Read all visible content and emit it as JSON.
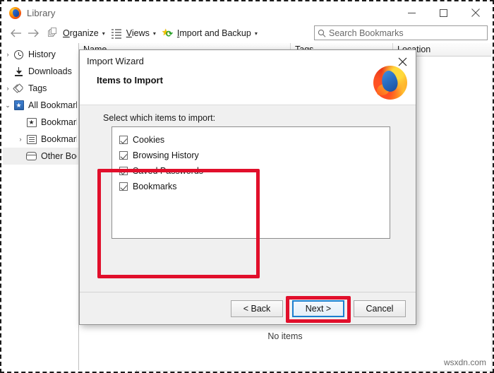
{
  "window": {
    "title": "Library",
    "app_icon": "firefox-icon",
    "controls": {
      "minimize": "minimize-icon",
      "maximize": "maximize-icon",
      "close": "close-icon"
    }
  },
  "toolbar": {
    "back": "back-arrow-icon",
    "forward": "forward-arrow-icon",
    "items": [
      {
        "label": "Organize",
        "key": "O",
        "rest": "rganize",
        "icon": "organize-icon",
        "caret": "▾"
      },
      {
        "label": "Views",
        "key": "V",
        "rest": "iews",
        "icon": "views-icon",
        "caret": "▾"
      },
      {
        "label": "Import and Backup",
        "key": "I",
        "rest": "mport and Backup",
        "icon": "import-backup-icon",
        "caret": "▾"
      }
    ]
  },
  "search": {
    "placeholder": "Search Bookmarks",
    "value": "",
    "icon": "search-icon"
  },
  "sidebar": {
    "items": [
      {
        "label": "History",
        "icon": "clock-icon",
        "twisty": "›",
        "indent": 0,
        "selected": false
      },
      {
        "label": "Downloads",
        "icon": "download-icon",
        "twisty": "",
        "indent": 0,
        "selected": false
      },
      {
        "label": "Tags",
        "icon": "tag-icon",
        "twisty": "›",
        "indent": 0,
        "selected": false
      },
      {
        "label": "All Bookmarks",
        "icon": "all-bookmarks-icon",
        "twisty": "⌄",
        "indent": 0,
        "selected": false
      },
      {
        "label": "Bookmarks Toolbar",
        "icon": "bookmarks-toolbar-icon",
        "twisty": "",
        "indent": 1,
        "selected": false
      },
      {
        "label": "Bookmarks Menu",
        "icon": "bookmarks-menu-icon",
        "twisty": "›",
        "indent": 1,
        "selected": false
      },
      {
        "label": "Other Bookmarks",
        "icon": "other-bookmarks-icon",
        "twisty": "",
        "indent": 1,
        "selected": true
      }
    ]
  },
  "content": {
    "columns": [
      "Name",
      "Tags",
      "Location"
    ],
    "empty_message": "No items"
  },
  "dialog": {
    "title": "Import Wizard",
    "subtitle": "Items to Import",
    "logo": "firefox-logo",
    "close_icon": "close-icon",
    "select_label": "Select which items to import:",
    "checkboxes": [
      {
        "label": "Cookies",
        "checked": true
      },
      {
        "label": "Browsing History",
        "checked": true
      },
      {
        "label": "Saved Passwords",
        "checked": true
      },
      {
        "label": "Bookmarks",
        "checked": true
      }
    ],
    "buttons": [
      {
        "label": "< Back",
        "focused": false
      },
      {
        "label": "Next >",
        "focused": true
      },
      {
        "label": "Cancel",
        "focused": false
      }
    ]
  },
  "annotations": {
    "highlight_color": "#e10f2b",
    "focus_color": "#1b7fcf"
  },
  "watermark": "wsxdn.com"
}
